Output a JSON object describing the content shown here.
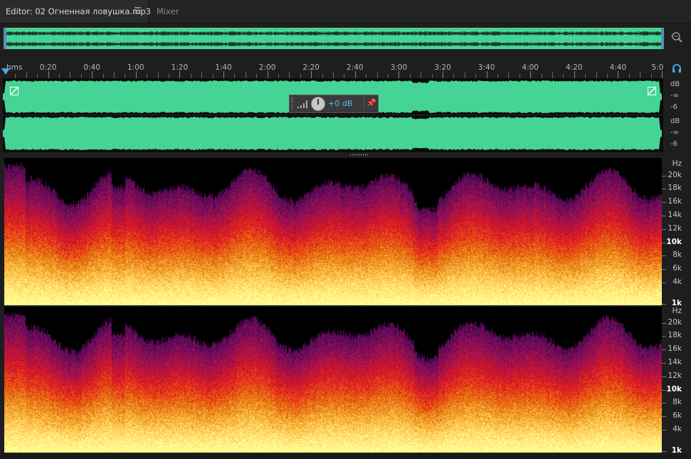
{
  "tabs": {
    "editor_label": "Editor: 02 Огненная ловушка.mp3",
    "mixer_label": "Mixer"
  },
  "icons": {
    "tab_menu": "hamburger-menu-icon",
    "zoom": "zoom-magnifier-icon",
    "headphone": "headphone-monitor-icon",
    "level": "level-meter-icon",
    "pin": "pin-icon",
    "playhead": "playhead-marker-icon"
  },
  "colors": {
    "waveform": "#46d496",
    "accent": "#4aa3df",
    "hud_gain": "#5cb8f2"
  },
  "ruler": {
    "unit": "hms",
    "ticks": [
      "0:20",
      "0:40",
      "1:00",
      "1:20",
      "1:40",
      "2:00",
      "2:20",
      "2:40",
      "3:00",
      "3:20",
      "3:40",
      "4:00",
      "4:20",
      "4:40",
      "5:0"
    ]
  },
  "hud": {
    "gain": "+0 dB"
  },
  "amplitude": {
    "ch1": [
      "dB",
      "-∞",
      "-6"
    ],
    "ch2": [
      "dB",
      "-∞",
      "-6"
    ]
  },
  "frequency": {
    "labels": [
      "Hz",
      "20k",
      "18k",
      "16k",
      "14k",
      "12k",
      "10k",
      "8k",
      "6k",
      "4k",
      "1k"
    ]
  }
}
